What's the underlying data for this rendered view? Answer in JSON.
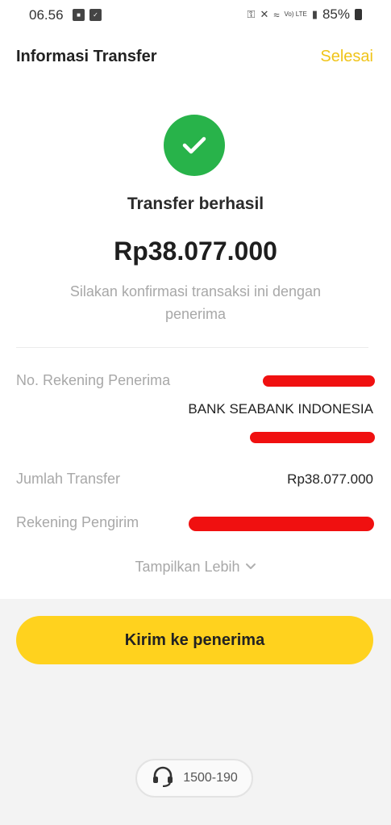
{
  "status_bar": {
    "time": "06.56",
    "battery": "85%",
    "network": "Vo) LTE"
  },
  "header": {
    "title": "Informasi Transfer",
    "done_label": "Selesai"
  },
  "result": {
    "title": "Transfer berhasil",
    "amount": "Rp38.077.000",
    "message": "Silakan konfirmasi transaksi ini dengan penerima"
  },
  "details": {
    "recipient_account_label": "No. Rekening Penerima",
    "recipient_bank": "BANK SEABANK INDONESIA",
    "transfer_amount_label": "Jumlah Transfer",
    "transfer_amount": "Rp38.077.000",
    "sender_account_label": "Rekening Pengirim"
  },
  "show_more_label": "Tampilkan Lebih",
  "send_button_label": "Kirim ke penerima",
  "support": {
    "phone": "1500-190"
  },
  "colors": {
    "accent_yellow": "#ffd21e",
    "done_yellow": "#f0c419",
    "success_green": "#28b34a",
    "redaction_red": "#f01010"
  }
}
